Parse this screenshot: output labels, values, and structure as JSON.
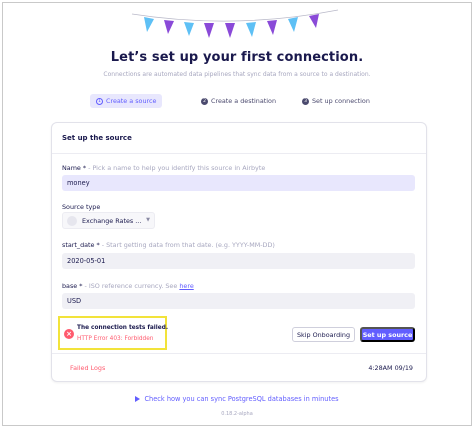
{
  "header": {
    "title": "Let’s set up your first connection.",
    "subtitle": "Connections are automated data pipelines that sync data from a source to a destination."
  },
  "steps": [
    {
      "num": "1",
      "label": "Create a source"
    },
    {
      "num": "2",
      "label": "Create a destination"
    },
    {
      "num": "3",
      "label": "Set up connection"
    }
  ],
  "form": {
    "title": "Set up the source",
    "name_label": "Name *",
    "name_hint": " - Pick a name to help you identify this source in Airbyte",
    "name_value": "money",
    "source_type_label": "Source type",
    "source_type_value": "Exchange Rates ...",
    "start_date_label": "start_date *",
    "start_date_hint": " - Start getting data from that date. (e.g. YYYY-MM-DD)",
    "start_date_value": "2020-05-01",
    "base_label": "base *",
    "base_hint": " - ISO reference currency. See ",
    "base_hint_link": "here",
    "base_value": "USD"
  },
  "error": {
    "title": "The connection tests failed.",
    "message": "HTTP Error 403: Forbidden"
  },
  "buttons": {
    "skip": "Skip Onboarding",
    "setup": "Set up source"
  },
  "logs": {
    "failed_label": "Failed Logs",
    "timestamp": "4:28AM 09/19"
  },
  "footer": {
    "link": "Check how you can sync PostgreSQL databases in minutes",
    "version": "0.18.2-alpha"
  },
  "colors": {
    "accent": "#625eff",
    "error": "#ff5a6e",
    "highlight": "#f2e33a",
    "pennant_light": "#5ec0f5",
    "pennant_dark": "#8a4ad8"
  }
}
